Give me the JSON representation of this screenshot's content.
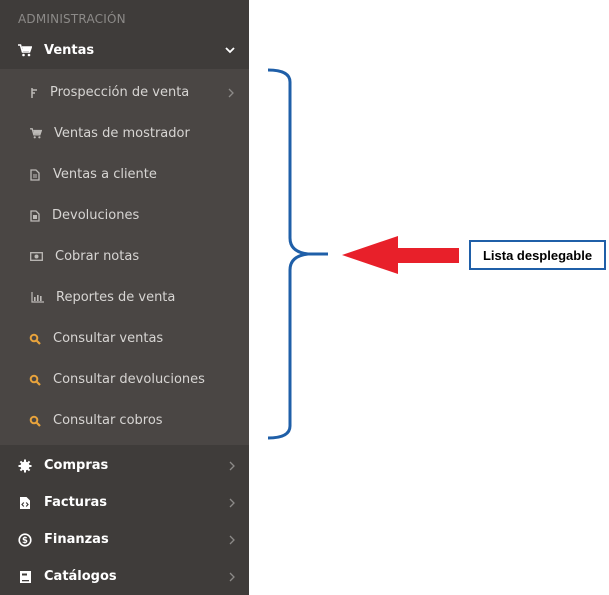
{
  "sidebar": {
    "section_header": "ADMINISTRACIÓN",
    "ventas": {
      "label": "Ventas",
      "icon": "cart-icon",
      "expanded": true
    },
    "submenu": [
      {
        "label": "Prospección de venta",
        "icon": "filter-icon",
        "has_children": true
      },
      {
        "label": "Ventas de mostrador",
        "icon": "cart-icon"
      },
      {
        "label": "Ventas a cliente",
        "icon": "document-icon"
      },
      {
        "label": "Devoluciones",
        "icon": "document-return-icon"
      },
      {
        "label": "Cobrar notas",
        "icon": "money-icon"
      },
      {
        "label": "Reportes de venta",
        "icon": "bar-chart-icon"
      },
      {
        "label": "Consultar ventas",
        "icon": "search-icon"
      },
      {
        "label": "Consultar devoluciones",
        "icon": "search-icon"
      },
      {
        "label": "Consultar cobros",
        "icon": "search-icon"
      }
    ],
    "menus": [
      {
        "label": "Compras",
        "icon": "gear-icon"
      },
      {
        "label": "Facturas",
        "icon": "invoice-code-icon"
      },
      {
        "label": "Finanzas",
        "icon": "dollar-circle-icon"
      },
      {
        "label": "Catálogos",
        "icon": "book-icon"
      }
    ]
  },
  "annotation": {
    "label": "Lista desplegable"
  },
  "colors": {
    "sidebar_bg": "#3f3c3a",
    "submenu_bg": "#4a4644",
    "search_icon": "#e8a33c",
    "bracket": "#1f5fa8",
    "arrow": "#e8202a"
  }
}
